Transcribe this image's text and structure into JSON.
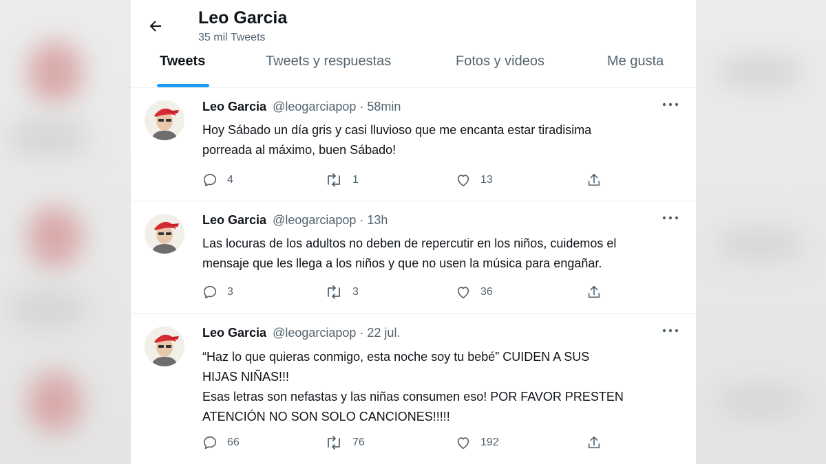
{
  "profile": {
    "name": "Leo Garcia",
    "tweet_count": "35 mil Tweets"
  },
  "tabs": [
    {
      "label": "Tweets",
      "active": true
    },
    {
      "label": "Tweets y respuestas",
      "active": false
    },
    {
      "label": "Fotos y videos",
      "active": false
    },
    {
      "label": "Me gusta",
      "active": false
    }
  ],
  "tweets": [
    {
      "name": "Leo Garcia",
      "meta": "@leogarciapop · 58min",
      "lines": [
        "Hoy Sábado un día gris y casi lluvioso que me encanta estar tiradisima",
        "porreada al máximo, buen Sábado!"
      ],
      "replies": "4",
      "retweets": "1",
      "likes": "13"
    },
    {
      "name": "Leo Garcia",
      "meta": "@leogarciapop · 13h",
      "lines": [
        "Las locuras de los adultos no deben de repercutir en los niños, cuidemos el",
        "mensaje que les llega a los niños y que no usen la música para engañar."
      ],
      "replies": "3",
      "retweets": "3",
      "likes": "36"
    },
    {
      "name": "Leo Garcia",
      "meta": "@leogarciapop · 22 jul.",
      "lines": [
        "“Haz lo que quieras conmigo, esta noche soy tu bebé” CUIDEN A SUS",
        "HIJAS NIÑAS!!!",
        "Esas letras son nefastas y las niñas consumen eso! POR FAVOR PRESTEN",
        "ATENCIÓN NO SON SOLO CANCIONES!!!!!"
      ],
      "replies": "66",
      "retweets": "76",
      "likes": "192"
    }
  ],
  "icons": {
    "back": "arrow-left-icon",
    "more": "more-dots-icon",
    "reply": "reply-bubble-icon",
    "retweet": "retweet-icon",
    "like": "heart-icon",
    "share": "share-icon"
  },
  "colors": {
    "accent": "#1d9bf0",
    "text": "#0f1419",
    "muted": "#536471"
  }
}
